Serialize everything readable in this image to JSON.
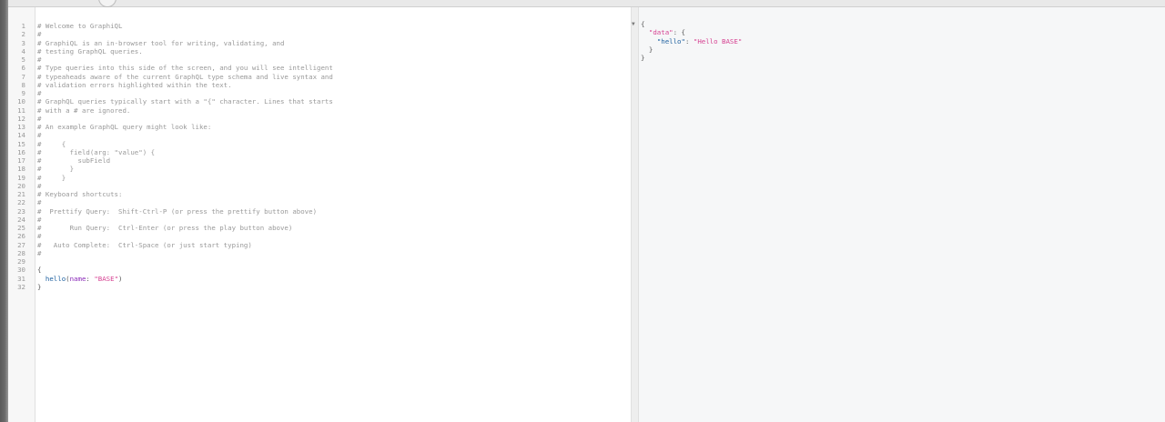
{
  "query_editor": {
    "lines": [
      {
        "n": "1",
        "text": "# Welcome to GraphiQL"
      },
      {
        "n": "2",
        "text": "#"
      },
      {
        "n": "3",
        "text": "# GraphiQL is an in-browser tool for writing, validating, and"
      },
      {
        "n": "4",
        "text": "# testing GraphQL queries."
      },
      {
        "n": "5",
        "text": "#"
      },
      {
        "n": "6",
        "text": "# Type queries into this side of the screen, and you will see intelligent"
      },
      {
        "n": "7",
        "text": "# typeaheads aware of the current GraphQL type schema and live syntax and"
      },
      {
        "n": "8",
        "text": "# validation errors highlighted within the text."
      },
      {
        "n": "9",
        "text": "#"
      },
      {
        "n": "10",
        "text": "# GraphQL queries typically start with a \"{\" character. Lines that starts"
      },
      {
        "n": "11",
        "text": "# with a # are ignored."
      },
      {
        "n": "12",
        "text": "#"
      },
      {
        "n": "13",
        "text": "# An example GraphQL query might look like:"
      },
      {
        "n": "14",
        "text": "#"
      },
      {
        "n": "15",
        "text": "#     {"
      },
      {
        "n": "16",
        "text": "#       field(arg: \"value\") {"
      },
      {
        "n": "17",
        "text": "#         subField"
      },
      {
        "n": "18",
        "text": "#       }"
      },
      {
        "n": "19",
        "text": "#     }"
      },
      {
        "n": "20",
        "text": "#"
      },
      {
        "n": "21",
        "text": "# Keyboard shortcuts:"
      },
      {
        "n": "22",
        "text": "#"
      },
      {
        "n": "23",
        "text": "#  Prettify Query:  Shift-Ctrl-P (or press the prettify button above)"
      },
      {
        "n": "24",
        "text": "#"
      },
      {
        "n": "25",
        "text": "#       Run Query:  Ctrl-Enter (or press the play button above)"
      },
      {
        "n": "26",
        "text": "#"
      },
      {
        "n": "27",
        "text": "#   Auto Complete:  Ctrl-Space (or just start typing)"
      },
      {
        "n": "28",
        "text": "#"
      },
      {
        "n": "29",
        "text": ""
      },
      {
        "n": "30",
        "text": "{"
      },
      {
        "n": "31",
        "text": ""
      },
      {
        "n": "32",
        "text": "}"
      }
    ],
    "query": {
      "field": "hello",
      "arg_name": "name",
      "arg_value": "\"BASE\""
    }
  },
  "result_viewer": {
    "open_brace": "{",
    "data_key": "\"data\"",
    "hello_key": "\"hello\"",
    "hello_value": "\"Hello BASE\"",
    "inner_close": "}",
    "close_brace": "}",
    "fold_icon": "triangle-down"
  }
}
